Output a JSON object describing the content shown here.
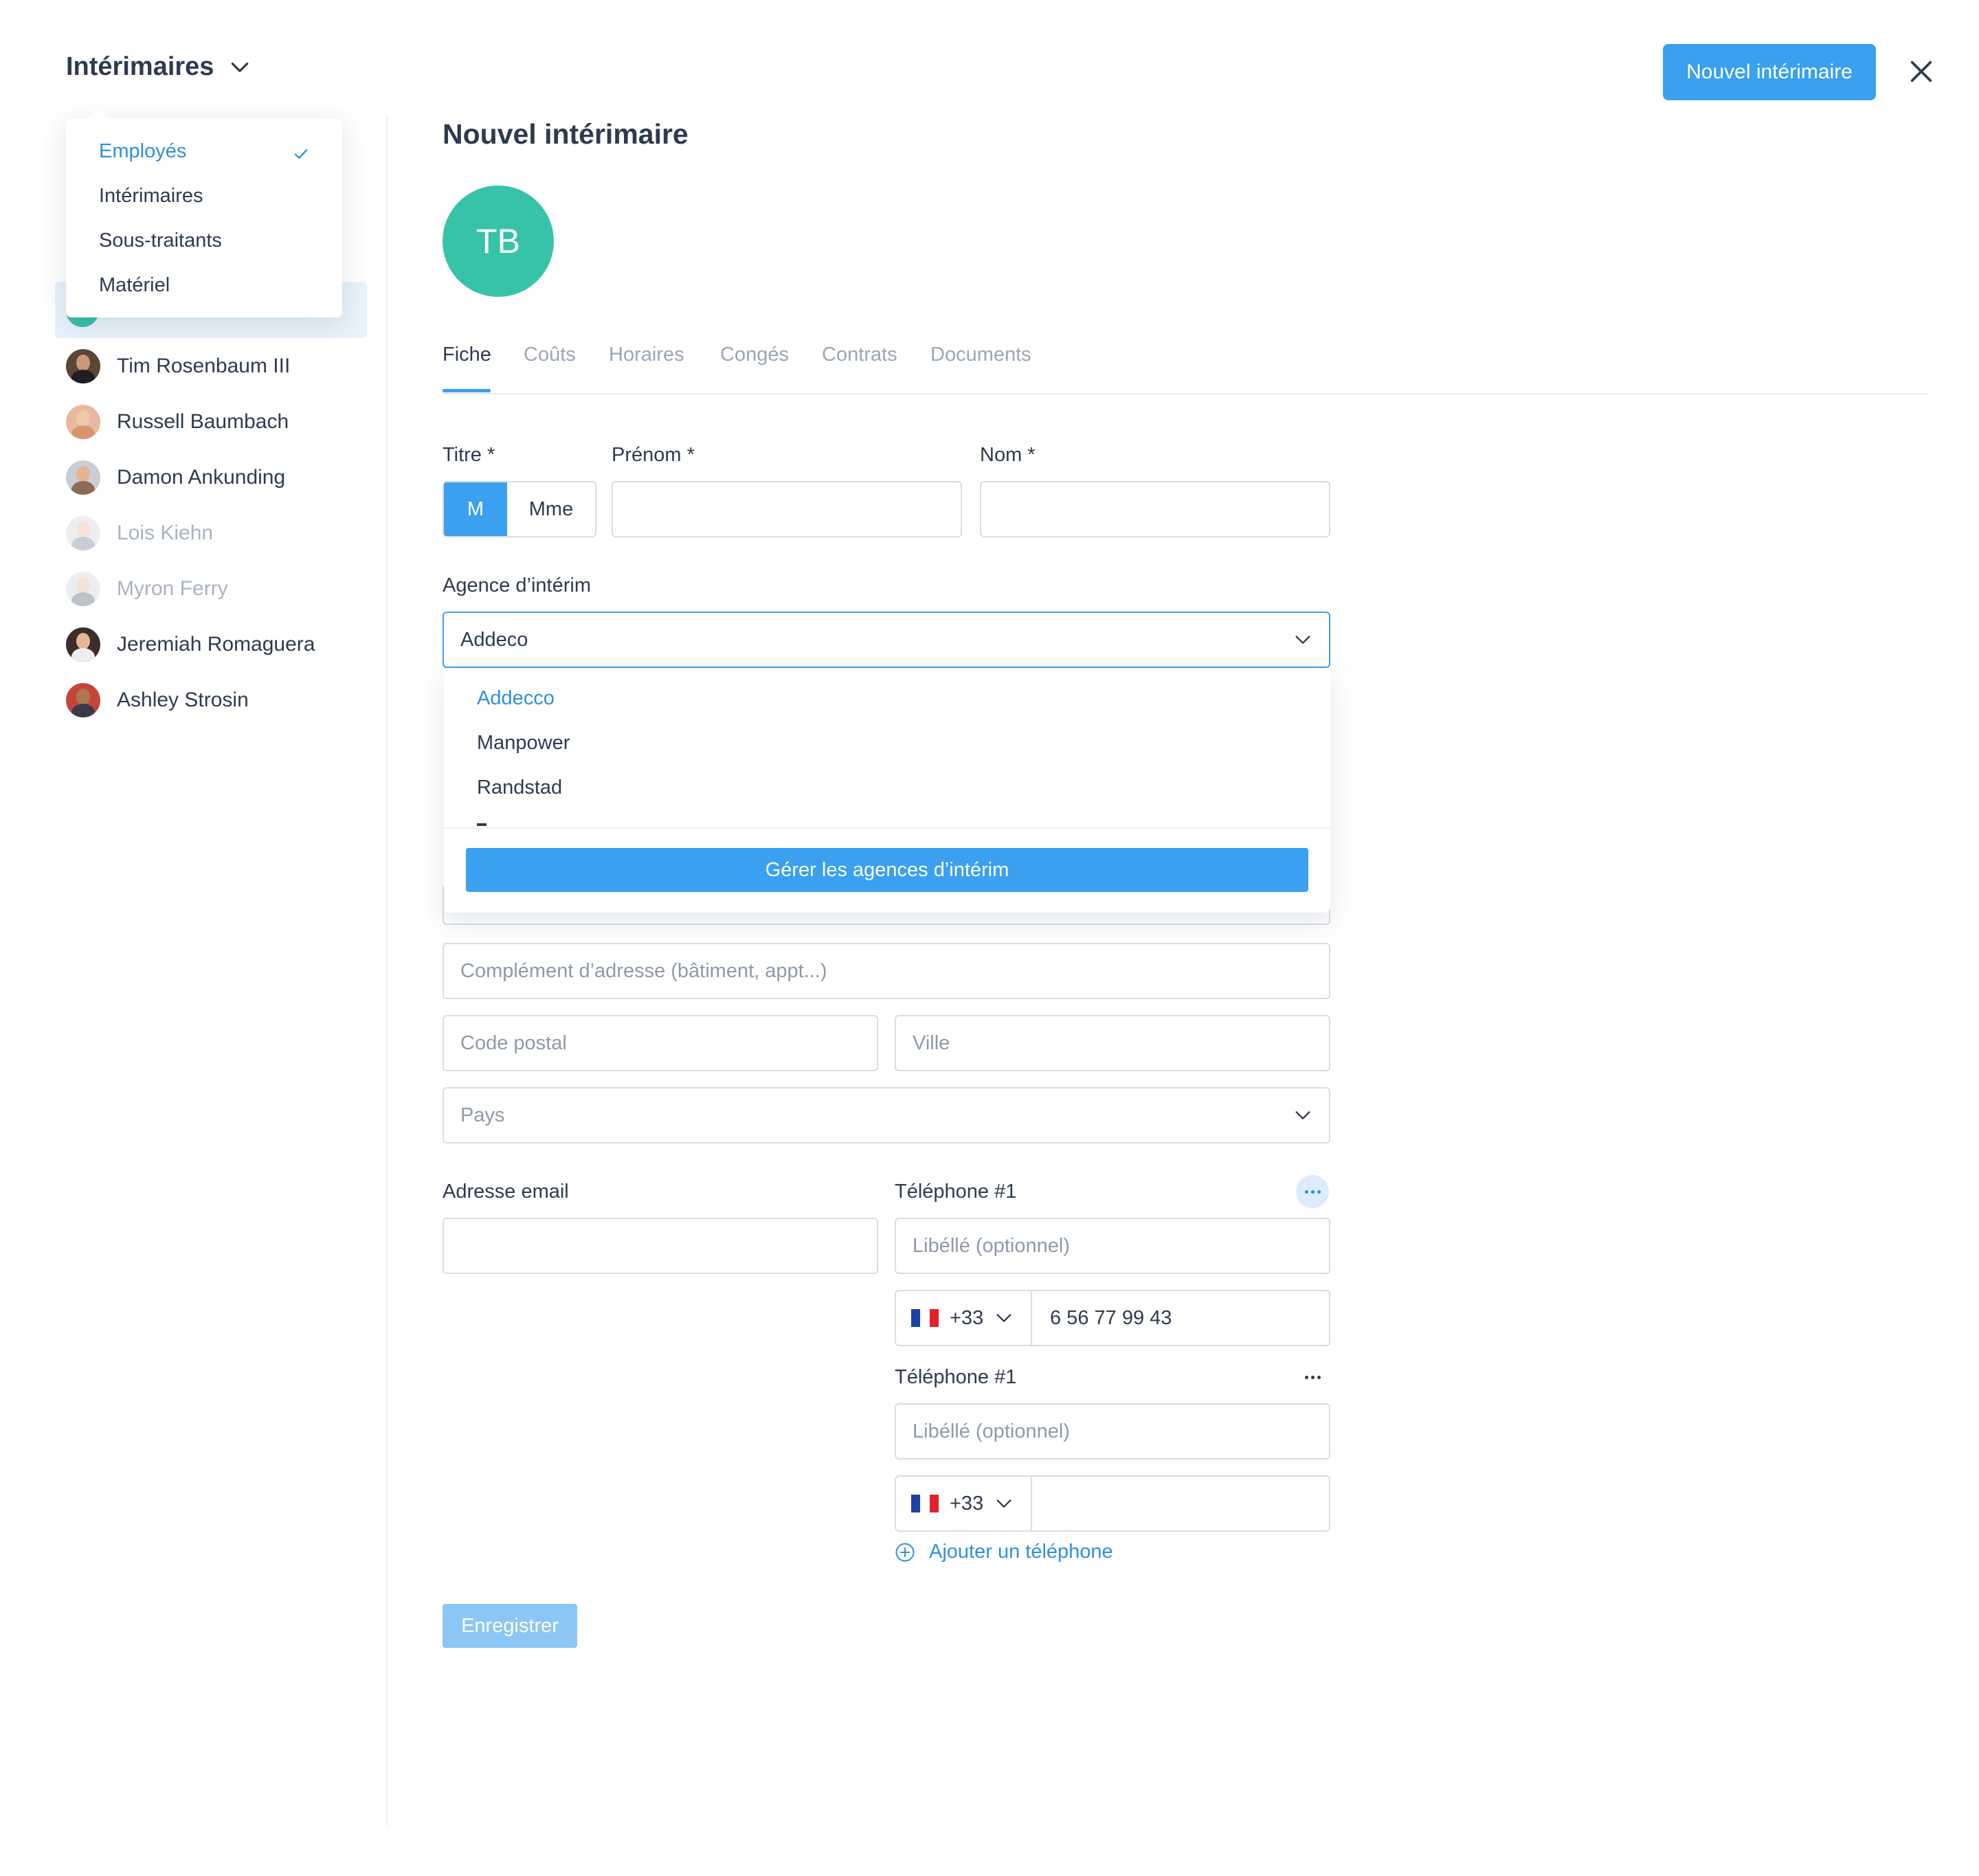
{
  "header": {
    "section_title": "Intérimaires",
    "new_button": "Nouvel intérimaire"
  },
  "type_menu": {
    "items": [
      {
        "label": "Employés",
        "selected": true
      },
      {
        "label": "Intérimaires",
        "selected": false
      },
      {
        "label": "Sous-traitants",
        "selected": false
      },
      {
        "label": "Matériel",
        "selected": false
      }
    ]
  },
  "people": [
    {
      "name": "Tim Rosenbaum III",
      "active": true
    },
    {
      "name": "Russell Baumbach",
      "active": true
    },
    {
      "name": "Damon Ankunding",
      "active": true
    },
    {
      "name": "Lois Kiehn",
      "active": false
    },
    {
      "name": "Myron Ferry",
      "active": false
    },
    {
      "name": "Jeremiah Romaguera",
      "active": true
    },
    {
      "name": "Ashley Strosin",
      "active": true
    }
  ],
  "form": {
    "title": "Nouvel intérimaire",
    "initials": "TB",
    "tabs": [
      "Fiche",
      "Coûts",
      "Horaires",
      "Congés",
      "Contrats",
      "Documents"
    ],
    "titre_label": "Titre *",
    "titre_options": [
      "M",
      "Mme"
    ],
    "prenom_label": "Prénom *",
    "nom_label": "Nom *",
    "agency_label": "Agence d’intérim",
    "agency_value": "Addeco",
    "agency_options": [
      "Addecco",
      "Manpower",
      "Randstad"
    ],
    "agency_manage_button": "Gérer les agences d’intérim",
    "address_complement_placeholder": "Complément d’adresse (bâtiment, appt...)",
    "postal_code_placeholder": "Code postal",
    "city_placeholder": "Ville",
    "country_placeholder": "Pays",
    "email_label": "Adresse email",
    "phones": [
      {
        "label": "Téléphone #1",
        "label_placeholder": "Libéllé (optionnel)",
        "prefix": "+33",
        "number": "6 56 77 99 43"
      },
      {
        "label": "Téléphone #1",
        "label_placeholder": "Libéllé (optionnel)",
        "prefix": "+33",
        "number": ""
      }
    ],
    "add_phone": "Ajouter un téléphone",
    "save_button": "Enregistrer"
  },
  "colors": {
    "accent": "#3aa0ef",
    "avatar_green": "#36c3a8",
    "text": "#2e3b4e",
    "muted": "#9aa6b4"
  }
}
